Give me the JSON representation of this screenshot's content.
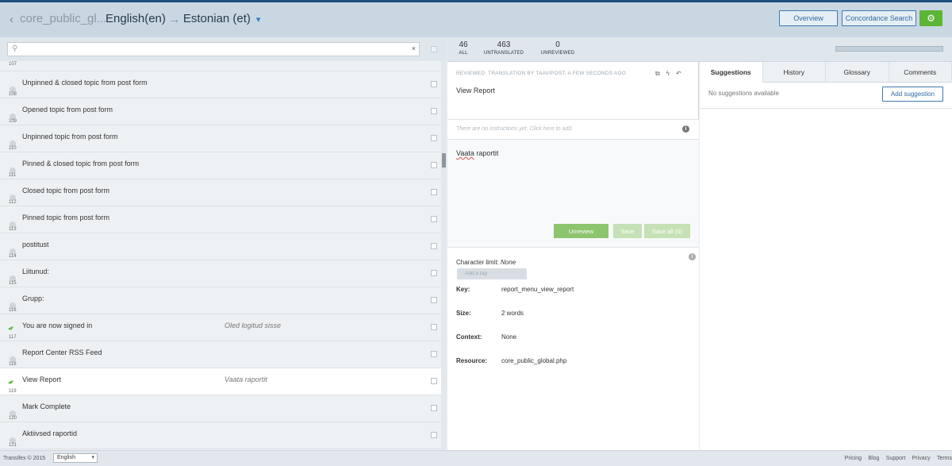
{
  "header": {
    "back_icon": "chevron-left-icon",
    "project_name": "core_public_gl...",
    "source_lang": "English(en)",
    "arrow": "→",
    "target_lang": "Estonian (et)",
    "overview_label": "Overview",
    "concordance_label": "Concordance Search",
    "settings_icon": "gear-icon"
  },
  "search": {
    "placeholder": "",
    "value": "",
    "clear": "×"
  },
  "list": {
    "first_num": "107",
    "rows": [
      {
        "num": "108",
        "source": "Unpinned & closed topic from post form",
        "translation": "",
        "reviewed": false,
        "selected": false
      },
      {
        "num": "109",
        "source": "Opened topic from post form",
        "translation": "",
        "reviewed": false,
        "selected": false
      },
      {
        "num": "110",
        "source": "Unpinned topic from post form",
        "translation": "",
        "reviewed": false,
        "selected": false
      },
      {
        "num": "111",
        "source": "Pinned & closed topic from post form",
        "translation": "",
        "reviewed": false,
        "selected": false
      },
      {
        "num": "112",
        "source": "Closed topic from post form",
        "translation": "",
        "reviewed": false,
        "selected": false
      },
      {
        "num": "113",
        "source": "Pinned topic from post form",
        "translation": "",
        "reviewed": false,
        "selected": false
      },
      {
        "num": "114",
        "source": "postitust",
        "translation": "",
        "reviewed": false,
        "selected": false
      },
      {
        "num": "115",
        "source": "Liitunud:",
        "translation": "",
        "reviewed": false,
        "selected": false
      },
      {
        "num": "116",
        "source": "Grupp:",
        "translation": "",
        "reviewed": false,
        "selected": false
      },
      {
        "num": "117",
        "source": "You are now signed in",
        "translation": "Oled logitud sisse",
        "reviewed": true,
        "selected": false
      },
      {
        "num": "118",
        "source": "Report Center RSS Feed",
        "translation": "",
        "reviewed": false,
        "selected": false
      },
      {
        "num": "119",
        "source": "View Report",
        "translation": "Vaata raportit",
        "reviewed": true,
        "selected": true
      },
      {
        "num": "120",
        "source": "Mark Complete",
        "translation": "",
        "reviewed": false,
        "selected": false
      },
      {
        "num": "121",
        "source": "Aktiivsed raportid",
        "translation": "",
        "reviewed": false,
        "selected": false
      }
    ]
  },
  "stats": {
    "all_count": "46",
    "all_label": "ALL",
    "untranslated_count": "463",
    "untranslated_label": "UNTRANSLATED",
    "unreviewed_count": "0",
    "unreviewed_label": "UNREVIEWED"
  },
  "editor": {
    "reviewed_note": "REVIEWED. TRANSLATION BY TAAVIPOST, A FEW SECONDS AGO",
    "source_text": "View Report",
    "instructions_placeholder": "There are no instructions yet. Click here to add.",
    "translation_word1": "Vaata",
    "translation_word2": " raportit",
    "unreview_label": "Unreview",
    "save_label": "Save",
    "save_all_label": "Save all (0)"
  },
  "meta": {
    "char_limit_label": "Character limit:",
    "char_limit_value": "None",
    "tag_placeholder": "Add a tag",
    "key_label": "Key:",
    "key_value": "report_menu_view_report",
    "size_label": "Size:",
    "size_value": "2 words",
    "context_label": "Context:",
    "context_value": "None",
    "resource_label": "Resource:",
    "resource_value": "core_public_global.php"
  },
  "right_panel": {
    "tabs": [
      "Suggestions",
      "History",
      "Glossary",
      "Comments"
    ],
    "active_tab": "Suggestions",
    "no_suggestions": "No suggestions available",
    "add_suggestion_label": "Add suggestion"
  },
  "footer": {
    "copyright": "Transifex © 2015",
    "language": "English",
    "links": [
      "Pricing",
      "Blog",
      "Support",
      "Privacy",
      "Terms"
    ]
  },
  "colors": {
    "accent": "#2d7dc2",
    "green": "#5cb536",
    "header_bg": "#c9d7e3"
  }
}
